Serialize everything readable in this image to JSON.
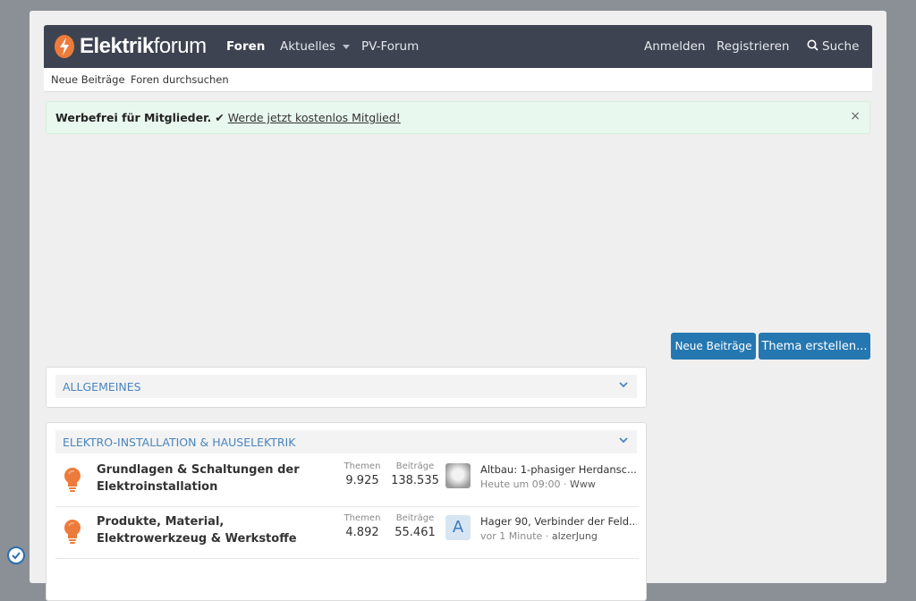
{
  "header": {
    "logo_bold": "Elektrik",
    "logo_rest": "forum",
    "nav": [
      "Foren",
      "Aktuelles",
      "PV-Forum"
    ],
    "anmelden": "Anmelden",
    "registrieren": "Registrieren",
    "suche": "Suche"
  },
  "subnav": [
    "Neue Beiträge",
    "Foren durchsuchen"
  ],
  "notice": {
    "bold": "Werbefrei für Mitglieder.",
    "check": "✔",
    "link": "Werde jetzt kostenlos Mitglied!",
    "close": "×"
  },
  "buttons": {
    "neue_beitraege": "Neue Beiträge",
    "thema_erstellen": "Thema erstellen..."
  },
  "categories": [
    {
      "title": "ALLGEMEINES"
    },
    {
      "title": "ELEKTRO-INSTALLATION & HAUSELEKTRIK"
    }
  ],
  "stat_labels": {
    "themen": "Themen",
    "beitraege": "Beiträge"
  },
  "forums": [
    {
      "title": "Grundlagen & Schaltungen der Elektroinstallation",
      "themen": "9.925",
      "beitraege": "138.535",
      "last_title": "Altbau: 1-phasiger Herdansc...",
      "last_time": "Heute um 09:00",
      "last_user": "Www",
      "avatar": ""
    },
    {
      "title": "Produkte, Material, Elektrowerkzeug & Werkstoffe",
      "themen": "4.892",
      "beitraege": "55.461",
      "last_title": "Hager 90, Verbinder der Feld...",
      "last_time": "vor 1 Minute",
      "last_user": "alzerJung",
      "avatar": "A"
    }
  ],
  "colors": {
    "accent": "#2577b1",
    "topbar": "#3d4350",
    "bulb": "#ec7b3b"
  }
}
